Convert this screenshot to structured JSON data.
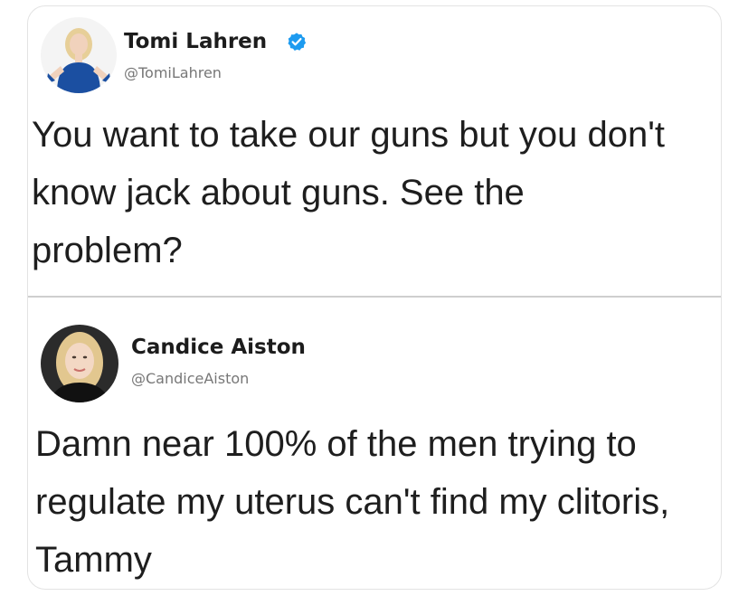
{
  "tweets": [
    {
      "author_name": "Tomi Lahren",
      "author_handle": "@TomiLahren",
      "verified": true,
      "avatar_icon": "profile-photo-blonde-woman-blue-dress",
      "text": "You want to take our guns but you don't know jack about guns. See the problem?"
    },
    {
      "author_name": "Candice Aiston",
      "author_handle": "@CandiceAiston",
      "verified": false,
      "avatar_icon": "profile-photo-blonde-woman",
      "text": "Damn near 100% of the men trying to regulate my uterus can't find my clitoris, Tammy"
    }
  ],
  "colors": {
    "verified_badge": "#1d9bf0",
    "divider": "#cfcfcf",
    "handle": "#777777"
  }
}
